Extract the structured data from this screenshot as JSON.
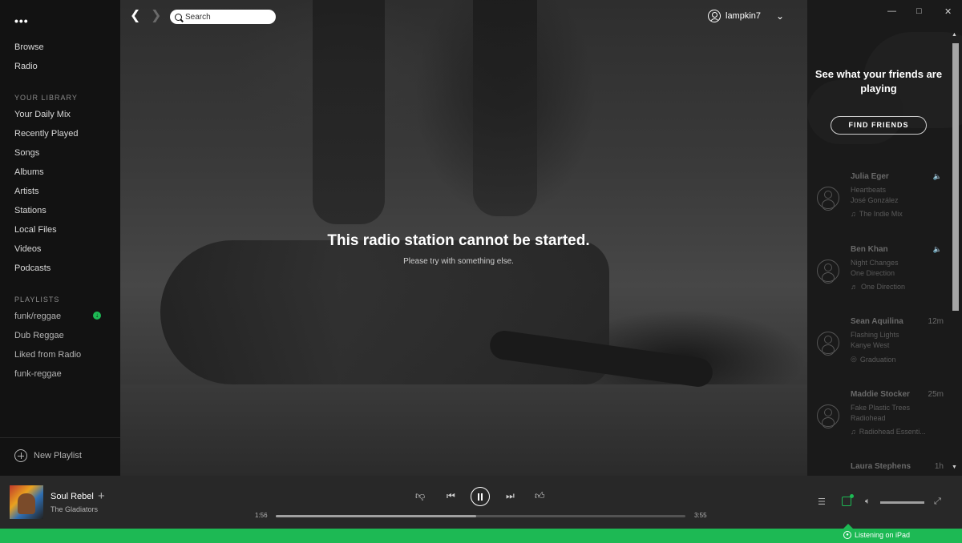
{
  "sidebar": {
    "menu_glyph": "•••",
    "nav": [
      "Browse",
      "Radio"
    ],
    "library_label": "YOUR LIBRARY",
    "library": [
      "Your Daily Mix",
      "Recently Played",
      "Songs",
      "Albums",
      "Artists",
      "Stations",
      "Local Files",
      "Videos",
      "Podcasts"
    ],
    "playlists_label": "PLAYLISTS",
    "playlists": [
      "funk/reggae",
      "Dub Reggae",
      "Liked from Radio",
      "funk-reggae"
    ],
    "new_playlist": "New Playlist"
  },
  "topbar": {
    "search_placeholder": "Search",
    "username": "lampkin7"
  },
  "hero": {
    "title": "This radio station cannot be started.",
    "subtitle": "Please try with something else."
  },
  "friends": {
    "heading": "See what your friends are playing",
    "find_button": "FIND FRIENDS",
    "list": [
      {
        "name": "Julia Eger",
        "time": "",
        "track": "Heartbeats",
        "artist": "José González",
        "context": "The Indie Mix",
        "context_icon": "music-note-icon",
        "live": true
      },
      {
        "name": "Ben Khan",
        "time": "",
        "track": "Night Changes",
        "artist": "One Direction",
        "context": "One Direction",
        "context_icon": "artist-icon",
        "live": true
      },
      {
        "name": "Sean Aquilina",
        "time": "12m",
        "track": "Flashing Lights",
        "artist": "Kanye West",
        "context": "Graduation",
        "context_icon": "album-icon",
        "live": false
      },
      {
        "name": "Maddie Stocker",
        "time": "25m",
        "track": "Fake Plastic Trees",
        "artist": "Radiohead",
        "context": "Radiohead Essenti...",
        "context_icon": "music-note-icon",
        "live": false
      },
      {
        "name": "Laura Stephens",
        "time": "1h",
        "track": "",
        "artist": "",
        "context": "",
        "context_icon": "",
        "live": false
      }
    ]
  },
  "player": {
    "song": "Soul Rebel",
    "artist": "The Gladiators",
    "elapsed": "1:56",
    "duration": "3:55",
    "progress_fraction": 0.49,
    "volume_fraction": 1.0
  },
  "status": {
    "listening": "Listening on iPad"
  },
  "colors": {
    "accent": "#1db954",
    "sidebar_bg": "#121212",
    "player_bg": "#282828",
    "friends_bg": "#1a1a1a"
  }
}
